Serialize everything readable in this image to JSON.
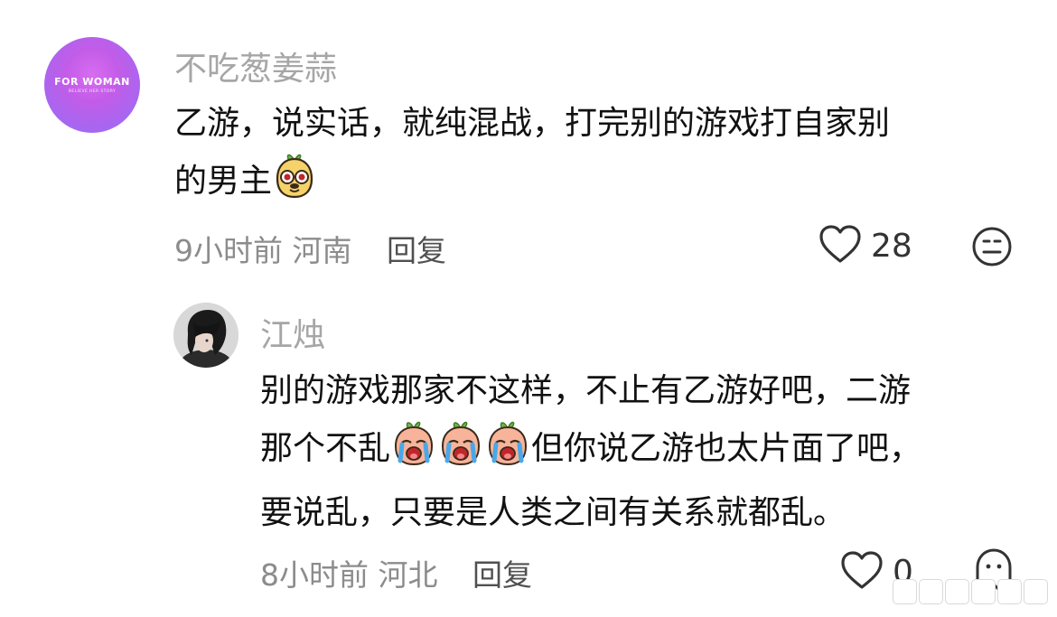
{
  "comments": [
    {
      "avatar": {
        "brand": "FOR WOMAN",
        "tagline": "BELIEVE HER STORY",
        "colors": [
          "#d86df0",
          "#9a70f2"
        ]
      },
      "username": "不吃葱姜蒜",
      "lines": [
        "乙游，说实话，就纯混战，打完别的游戏打自家别",
        "的男主"
      ],
      "emoji": "dog-face-emoji",
      "time": "9小时前",
      "location": "河南",
      "reply_label": "回复",
      "like_icon": "heart-outline-icon",
      "like_count": "28",
      "reaction_icon": "neutral-face-icon"
    },
    {
      "avatar": {
        "description_icon": "dark-hair-person-avatar"
      },
      "username": "江烛",
      "lines": [
        "别的游戏那家不这样，不止有乙游好吧，二游",
        "但你说乙游也太片面了吧，",
        "要说乱，只要是人类之间有关系就都乱。"
      ],
      "line2_prefix": "那个不乱",
      "emoji": "crying-face-emoji",
      "emoji_repeat": 3,
      "time": "8小时前",
      "location": "河北",
      "reply_label": "回复",
      "like_icon": "heart-outline-icon",
      "like_count": "0",
      "reaction_icon": "ghost-icon"
    }
  ],
  "colors": {
    "username": "#a6a6a6",
    "text": "#111111",
    "meta": "#8c8c8c",
    "reply": "#505050"
  }
}
